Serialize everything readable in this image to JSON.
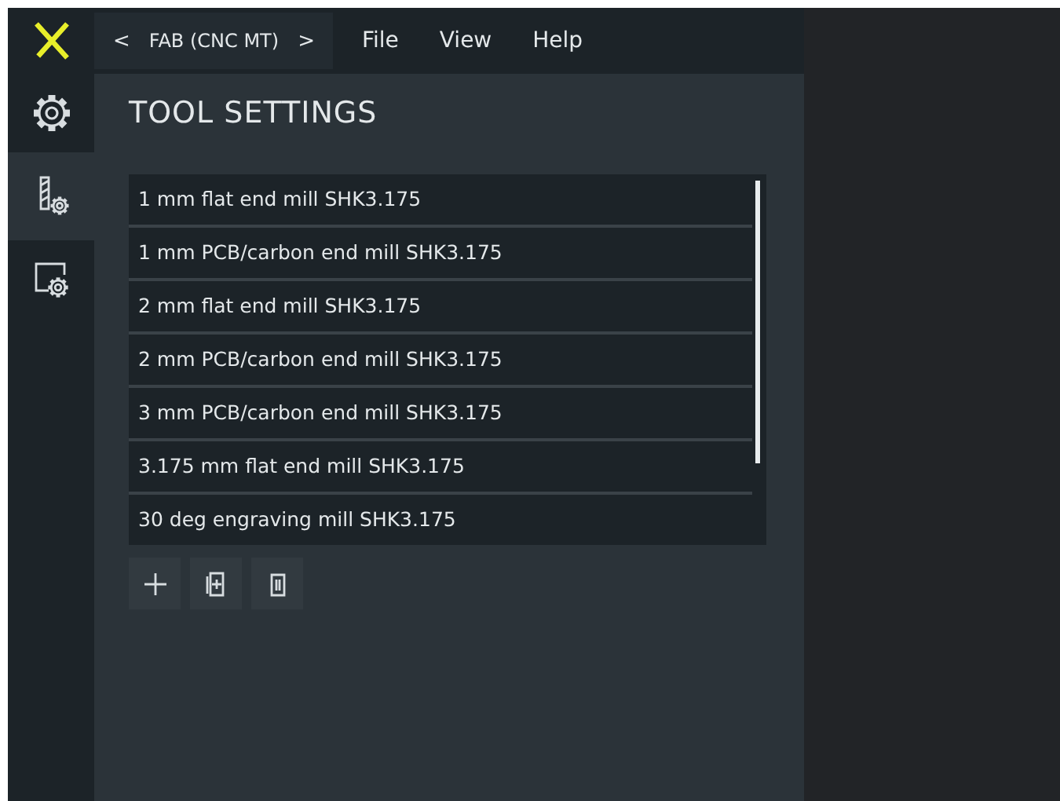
{
  "top_bar": {
    "breadcrumb": {
      "back": "<",
      "label": "FAB (CNC MT)",
      "forward": ">"
    },
    "menu": [
      "File",
      "View",
      "Help"
    ]
  },
  "sidebar": {
    "items": [
      {
        "kind": "settings",
        "selected": false
      },
      {
        "kind": "tool-settings",
        "selected": true
      },
      {
        "kind": "machine-settings",
        "selected": false
      }
    ]
  },
  "panel": {
    "title": "TOOL SETTINGS",
    "tools": [
      {
        "name": "1 mm flat end mill SHK3.175"
      },
      {
        "name": "1 mm PCB/carbon end mill SHK3.175"
      },
      {
        "name": "2 mm flat end mill SHK3.175"
      },
      {
        "name": "2 mm PCB/carbon end mill SHK3.175"
      },
      {
        "name": "3 mm PCB/carbon end mill SHK3.175"
      },
      {
        "name": "3.175 mm flat end mill SHK3.175"
      },
      {
        "name": "30 deg engraving mill SHK3.175"
      }
    ],
    "actions": [
      {
        "kind": "add"
      },
      {
        "kind": "duplicate"
      },
      {
        "kind": "delete"
      }
    ]
  }
}
